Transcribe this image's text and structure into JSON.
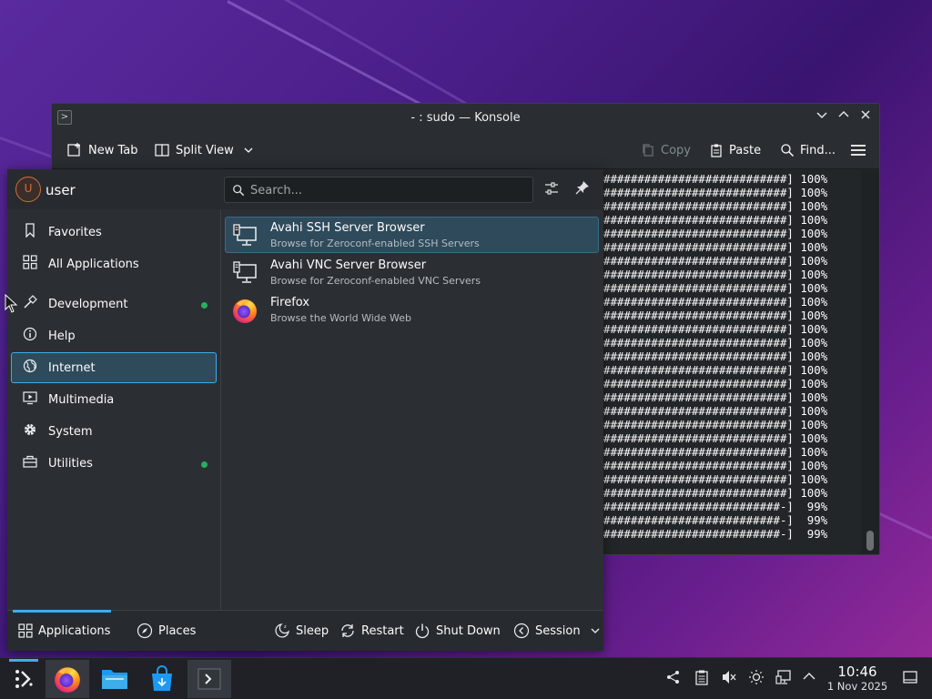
{
  "konsole": {
    "title": "- : sudo — Konsole",
    "toolbar": {
      "new_tab": "New Tab",
      "split_view": "Split View",
      "copy": "Copy",
      "paste": "Paste",
      "find": "Find..."
    },
    "terminal_lines": [
      "###########################] 100%",
      "###########################] 100%",
      "###########################] 100%",
      "###########################] 100%",
      "###########################] 100%",
      "###########################] 100%",
      "###########################] 100%",
      "###########################] 100%",
      "###########################] 100%",
      "###########################] 100%",
      "###########################] 100%",
      "###########################] 100%",
      "###########################] 100%",
      "###########################] 100%",
      "###########################] 100%",
      "###########################] 100%",
      "###########################] 100%",
      "###########################] 100%",
      "###########################] 100%",
      "###########################] 100%",
      "###########################] 100%",
      "###########################] 100%",
      "###########################] 100%",
      "###########################] 100%",
      "##########################-]  99%",
      "##########################-]  99%",
      "##########################-]  99%"
    ]
  },
  "launcher": {
    "avatar_letter": "U",
    "username": "user",
    "search_placeholder": "Search...",
    "categories": [
      {
        "label": "Favorites",
        "icon": "bookmark-icon"
      },
      {
        "label": "All Applications",
        "icon": "grid-icon"
      },
      {
        "label": "Development",
        "icon": "hammer-icon",
        "new": true
      },
      {
        "label": "Help",
        "icon": "info-icon"
      },
      {
        "label": "Internet",
        "icon": "globe-icon",
        "selected": true
      },
      {
        "label": "Multimedia",
        "icon": "monitor-play-icon"
      },
      {
        "label": "System",
        "icon": "gear-icon"
      },
      {
        "label": "Utilities",
        "icon": "toolbox-icon",
        "new": true
      }
    ],
    "apps": [
      {
        "name": "Avahi SSH Server Browser",
        "desc": "Browse for Zeroconf-enabled SSH Servers",
        "icon": "network-monitor-icon"
      },
      {
        "name": "Avahi VNC Server Browser",
        "desc": "Browse for Zeroconf-enabled VNC Servers",
        "icon": "network-monitor-icon"
      },
      {
        "name": "Firefox",
        "desc": "Browse the World Wide Web",
        "icon": "firefox-icon"
      }
    ],
    "footer": {
      "applications": "Applications",
      "places": "Places",
      "sleep": "Sleep",
      "restart": "Restart",
      "shutdown": "Shut Down",
      "session": "Session"
    }
  },
  "taskbar": {
    "time": "10:46",
    "date": "1 Nov 2025"
  }
}
